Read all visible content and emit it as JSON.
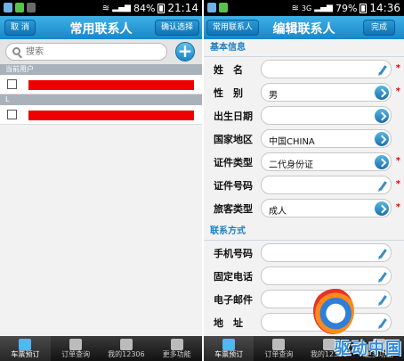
{
  "status_left": {
    "battery": "84%",
    "time": "21:14"
  },
  "status_right": {
    "network": "3G",
    "battery": "79%",
    "time": "14:36"
  },
  "contacts_screen": {
    "cancel_label": "取 消",
    "title": "常用联系人",
    "confirm_label": "确认选择",
    "search_placeholder": "搜索",
    "add_symbol": "+",
    "sections": [
      {
        "header": "当前用户"
      },
      {
        "header": "L"
      }
    ]
  },
  "edit_screen": {
    "back_label": "常用联系人",
    "title": "编辑联系人",
    "done_label": "完成",
    "basic_header": "基本信息",
    "basic_fields": [
      {
        "label": "姓　名",
        "value": ""
      },
      {
        "label": "性　别",
        "value": "男"
      },
      {
        "label": "出生日期",
        "value": ""
      },
      {
        "label": "国家地区",
        "value": "中国CHINA"
      },
      {
        "label": "证件类型",
        "value": "二代身份证"
      },
      {
        "label": "证件号码",
        "value": ""
      },
      {
        "label": "旅客类型",
        "value": "成人"
      }
    ],
    "required_mark": "*",
    "contact_header": "联系方式",
    "contact_fields": [
      {
        "label": "手机号码",
        "value": ""
      },
      {
        "label": "固定电话",
        "value": ""
      },
      {
        "label": "电子邮件",
        "value": ""
      },
      {
        "label": "地　址",
        "value": ""
      }
    ]
  },
  "tabbar": [
    "车票预订",
    "订单查询",
    "我的12306",
    "更多功能"
  ],
  "watermark_text": "驱动中国",
  "colors": {
    "titlebar": "#1a86c8",
    "accent": "#1e7ec3",
    "required": "#ee0000"
  }
}
